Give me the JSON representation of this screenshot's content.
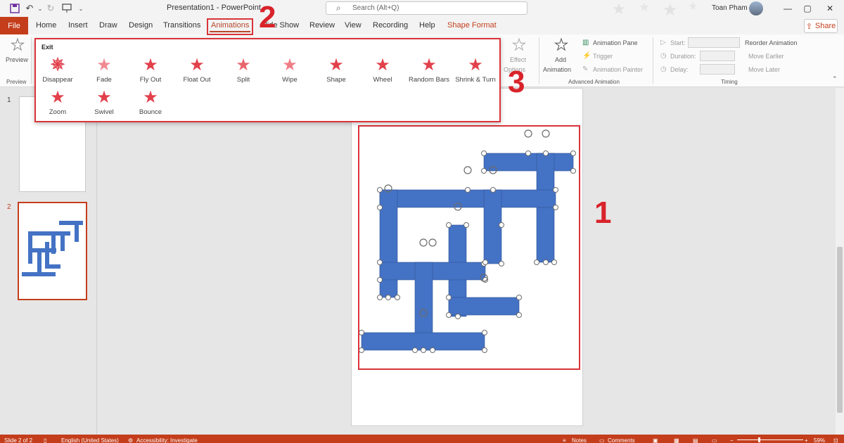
{
  "titlebar": {
    "doc_title": "Presentation1 - PowerPoint",
    "search_placeholder": "Search (Alt+Q)",
    "user_name": "Toan Pham"
  },
  "tabs": {
    "file": "File",
    "items": [
      "Home",
      "Insert",
      "Draw",
      "Design",
      "Transitions",
      "Animations",
      "Slide Show",
      "Review",
      "View",
      "Recording",
      "Help",
      "Shape Format"
    ],
    "active": "Animations",
    "share": "Share"
  },
  "ribbon": {
    "preview": {
      "label": "Preview",
      "group": "Preview"
    },
    "effect_options": {
      "label_1": "Effect",
      "label_2": "Options"
    },
    "advanced": {
      "add_1": "Add",
      "add_2": "Animation",
      "pane": "Animation Pane",
      "trigger": "Trigger",
      "painter": "Animation Painter",
      "group": "Advanced Animation"
    },
    "timing": {
      "start": "Start:",
      "duration": "Duration:",
      "delay": "Delay:",
      "reorder": "Reorder Animation",
      "earlier": "Move Earlier",
      "later": "Move Later",
      "group": "Timing"
    }
  },
  "gallery": {
    "title": "Exit",
    "items": [
      "Disappear",
      "Fade",
      "Fly Out",
      "Float Out",
      "Split",
      "Wipe",
      "Shape",
      "Wheel",
      "Random Bars",
      "Shrink & Turn",
      "Zoom",
      "Swivel",
      "Bounce"
    ]
  },
  "markers": {
    "one": "1",
    "two": "2",
    "three": "3"
  },
  "slides": {
    "num1": "1",
    "num2": "2"
  },
  "status": {
    "slide": "Slide 2 of 2",
    "language": "English (United States)",
    "accessibility": "Accessibility: Investigate",
    "notes": "Notes",
    "comments": "Comments",
    "zoom": "59%"
  },
  "colors": {
    "accent": "#c43e1c",
    "shape_fill": "#4472c4",
    "highlight": "#d9343a"
  }
}
